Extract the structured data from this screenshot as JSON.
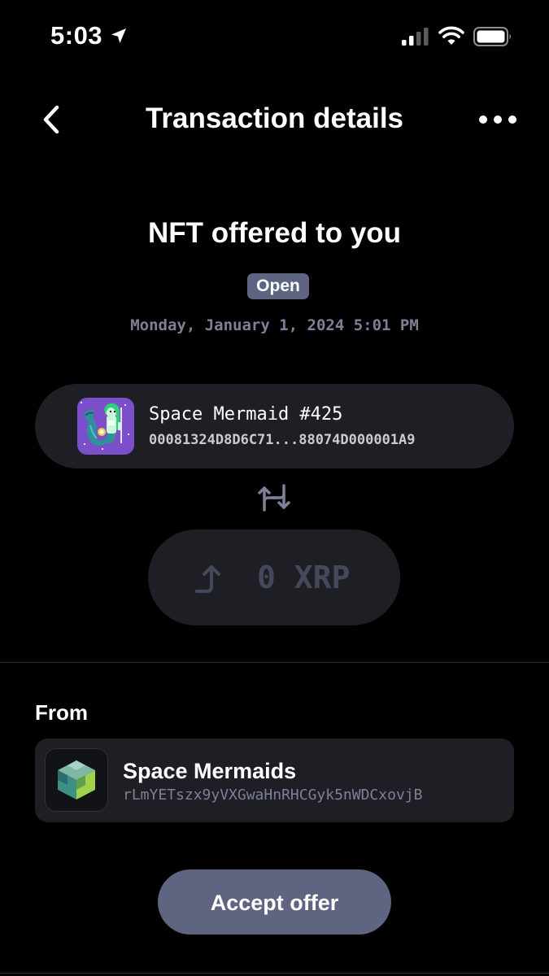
{
  "status_bar": {
    "time": "5:03",
    "icons": [
      "location-arrow-icon",
      "cellular-signal-icon",
      "wifi-icon",
      "battery-icon"
    ]
  },
  "header": {
    "title": "Transaction details",
    "back_icon": "chevron-left-icon",
    "more_icon": "ellipsis-icon"
  },
  "transaction": {
    "heading": "NFT offered to you",
    "status": "Open",
    "date": "Monday, January 1, 2024 5:01 PM",
    "swap_icon": "swap-arrows-icon"
  },
  "nft": {
    "name": "Space Mermaid #425",
    "token_id": "00081324D8D6C71...88074D000001A9",
    "thumbnail": "pixel-art-mermaid"
  },
  "amount": {
    "value": "0 XRP",
    "icon": "arrow-up-right-icon"
  },
  "from": {
    "label": "From",
    "name": "Space Mermaids",
    "address": "rLmYETszx9yVXGwaHnRHCGyk5nWDCxovjB",
    "logo": "cube-logo"
  },
  "actions": {
    "accept_label": "Accept offer"
  },
  "colors": {
    "background": "#000000",
    "card": "#1e1f24",
    "accent": "#5f6481",
    "muted_text": "#7d8096"
  }
}
